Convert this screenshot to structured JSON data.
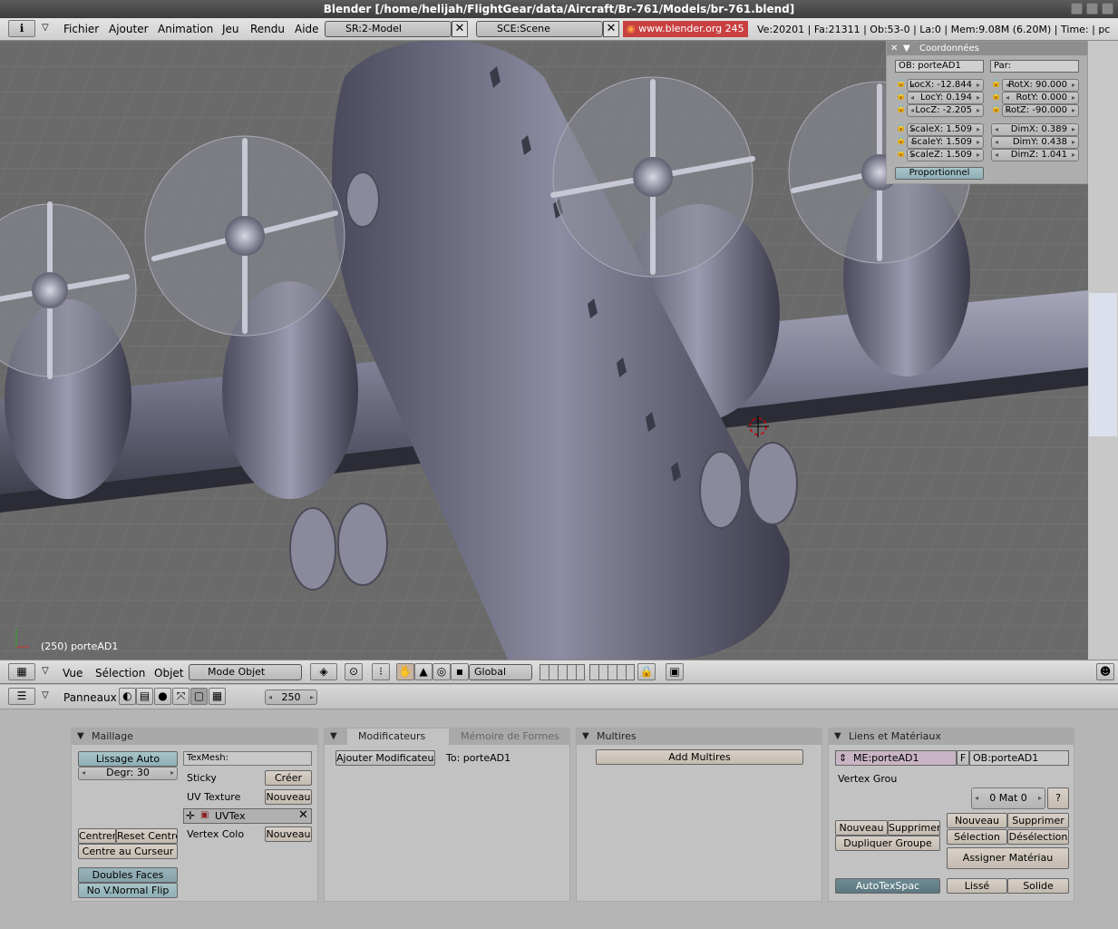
{
  "window": {
    "title": "Blender [/home/helijah/FlightGear/data/Aircraft/Br-761/Models/br-761.blend]"
  },
  "menu": {
    "items": [
      "Fichier",
      "Ajouter",
      "Animation",
      "Jeu",
      "Rendu",
      "Aide"
    ],
    "screen": "SR:2-Model",
    "scene": "SCE:Scene",
    "website": "www.blender.org 245",
    "stats": "Ve:20201 | Fa:21311 | Ob:53-0 | La:0  | Mem:9.08M (6.20M) | Time: | pc"
  },
  "transform": {
    "title": "Coordonnées",
    "ob": "OB: porteAD1",
    "par": "Par:",
    "loc": [
      "LocX: -12.844",
      "LocY: 0.194",
      "LocZ: -2.205"
    ],
    "rot": [
      "RotX: 90.000",
      "RotY: 0.000",
      "RotZ: -90.000"
    ],
    "scale": [
      "ScaleX: 1.509",
      "ScaleY: 1.509",
      "ScaleZ: 1.509"
    ],
    "dim": [
      "DimX: 0.389",
      "DimY: 0.438",
      "DimZ: 1.041"
    ],
    "proportional": "Proportionnel"
  },
  "viewport": {
    "object_info": "(250) porteAD1"
  },
  "view3d_header": {
    "menus": [
      "Vue",
      "Sélection",
      "Objet"
    ],
    "mode": "Mode Objet",
    "orientation": "Global"
  },
  "buttons_header": {
    "panels_label": "Panneaux",
    "frame": "250"
  },
  "maillage": {
    "title": "Maillage",
    "autosmooth": "Lissage Auto",
    "degr": "Degr: 30",
    "texmesh": "TexMesh:",
    "sticky": "Sticky",
    "create": "Créer",
    "uvtexture": "UV Texture",
    "new1": "Nouveau",
    "uvtex": "UVTex",
    "vertexcolor": "Vertex Colo",
    "new2": "Nouveau",
    "center": "Centrer",
    "reset_center": "Reset Centre",
    "center_cursor": "Centre au Curseur",
    "double_sided": "Doubles Faces",
    "no_vnormal": "No V.Normal Flip"
  },
  "modifiers": {
    "tab1": "Modificateurs",
    "tab2": "Mémoire de Formes",
    "add": "Ajouter Modificateur",
    "to": "To: porteAD1"
  },
  "multires": {
    "title": "Multires",
    "add": "Add Multires"
  },
  "links": {
    "title": "Liens et Matériaux",
    "me": "ME:porteAD1",
    "f": "F",
    "ob": "OB:porteAD1",
    "vgroup": "Vertex Grou",
    "mat": "0 Mat 0",
    "q": "?",
    "new": "Nouveau",
    "delete": "Supprimer",
    "new2": "Nouveau",
    "delete2": "Supprimer",
    "dup_group": "Dupliquer Groupe",
    "select": "Sélection",
    "deselect": "Désélection",
    "assign": "Assigner Matériau",
    "autotex": "AutoTexSpac",
    "smooth": "Lissé",
    "solid": "Solide"
  }
}
